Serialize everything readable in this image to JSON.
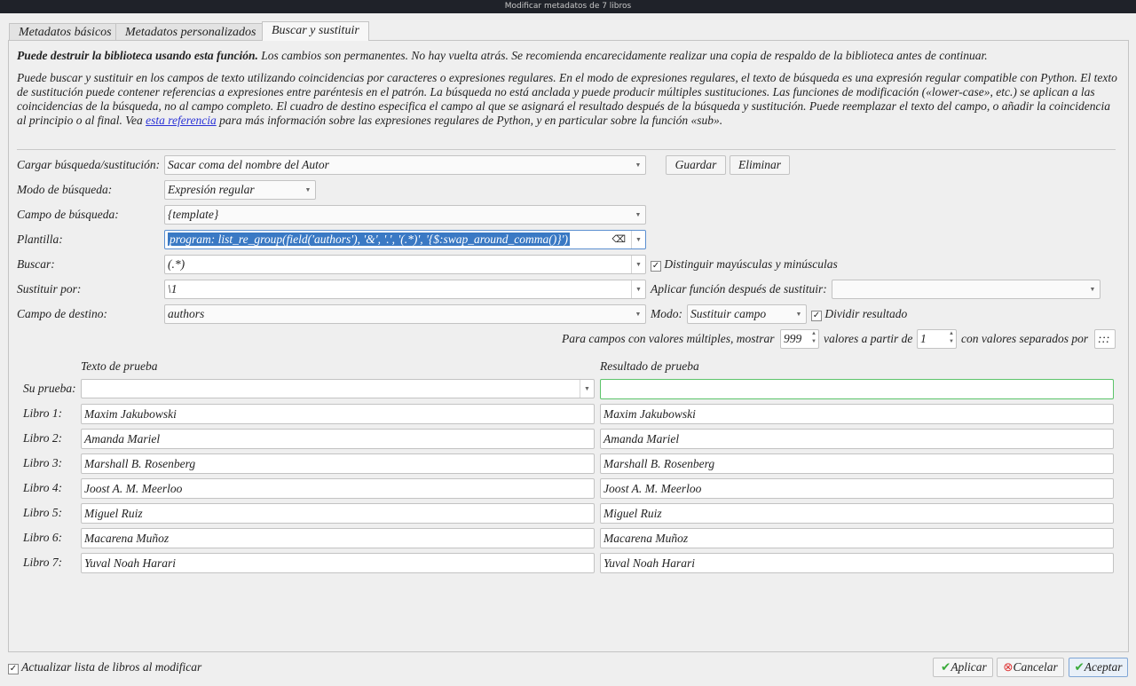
{
  "window": {
    "title": "Modificar metadatos de 7 libros"
  },
  "tabs": [
    {
      "label": "Metadatos básicos"
    },
    {
      "label": "Metadatos personalizados"
    },
    {
      "label": "Buscar y sustituir"
    }
  ],
  "warning": {
    "bold": "Puede destruir la biblioteca usando esta función.",
    "rest": " Los cambios son permanentes. No hay vuelta atrás. Se recomienda encarecidamente realizar una copia de respaldo de la biblioteca antes de continuar."
  },
  "help": {
    "before": "Puede buscar y sustituir en los campos de texto utilizando coincidencias por caracteres o expresiones regulares. En el modo de expresiones regulares, el texto de búsqueda es una expresión regular compatible con Python. El texto de sustitución puede contener referencias a expresiones entre paréntesis en el patrón. La búsqueda no está anclada y puede producir múltiples sustituciones. Las funciones de modificación («lower-case», etc.) se aplican a las coincidencias de la búsqueda, no al campo completo. El cuadro de destino especifica el campo al que se asignará el resultado después de la búsqueda y sustitución. Puede reemplazar el texto del campo, o añadir la coincidencia al principio o al final. Vea ",
    "link": "esta referencia",
    "after": " para más información sobre las expresiones regulares de Python, y en particular sobre la función «sub»."
  },
  "form": {
    "load_label": "Cargar búsqueda/sustitución:",
    "load_value": "Sacar coma del nombre del Autor",
    "save": "Guardar",
    "delete": "Eliminar",
    "mode_label": "Modo de búsqueda:",
    "mode_value": "Expresión regular",
    "field_label": "Campo de búsqueda:",
    "field_value": "{template}",
    "template_label": "Plantilla:",
    "template_value": "program:     list_re_group(field('authors'), '&', '.', '(.*)', '{$:swap_around_comma()}')",
    "search_label": "Buscar:",
    "search_value": "(.*)",
    "case_label": "Distinguir mayúsculas y minúsculas",
    "case_checked": true,
    "replace_label": "Sustituir por:",
    "replace_value": "\\1",
    "func_label": "Aplicar función después de sustituir:",
    "func_value": "",
    "dest_label": "Campo de destino:",
    "dest_value": "authors",
    "dmode_label": "Modo:",
    "dmode_value": "Sustituir campo",
    "split_label": "Dividir resultado",
    "split_checked": true,
    "multi_label": "Para campos con valores múltiples, mostrar",
    "multi_count": "999",
    "multi_from_label": "valores a partir de",
    "multi_from": "1",
    "multi_sep_label": "con valores separados por",
    "multi_sep": ":::"
  },
  "test": {
    "text_header": "Texto de prueba",
    "result_header": "Resultado de prueba",
    "your_test": "Su prueba:",
    "rows": [
      {
        "label": "Libro 1:",
        "text": "Maxim Jakubowski",
        "result": "Maxim Jakubowski"
      },
      {
        "label": "Libro 2:",
        "text": "Amanda Mariel",
        "result": "Amanda Mariel"
      },
      {
        "label": "Libro 3:",
        "text": "Marshall B. Rosenberg",
        "result": "Marshall B. Rosenberg"
      },
      {
        "label": "Libro 4:",
        "text": "Joost A. M. Meerloo",
        "result": "Joost A. M. Meerloo"
      },
      {
        "label": "Libro 5:",
        "text": "Miguel Ruiz",
        "result": "Miguel Ruiz"
      },
      {
        "label": "Libro 6:",
        "text": "Macarena Muñoz",
        "result": "Macarena Muñoz"
      },
      {
        "label": "Libro 7:",
        "text": "Yuval Noah Harari",
        "result": "Yuval Noah Harari"
      }
    ]
  },
  "footer": {
    "update_label": "Actualizar lista de libros al modificar",
    "update_checked": true,
    "apply": "Aplicar",
    "cancel": "Cancelar",
    "accept": "Aceptar"
  }
}
